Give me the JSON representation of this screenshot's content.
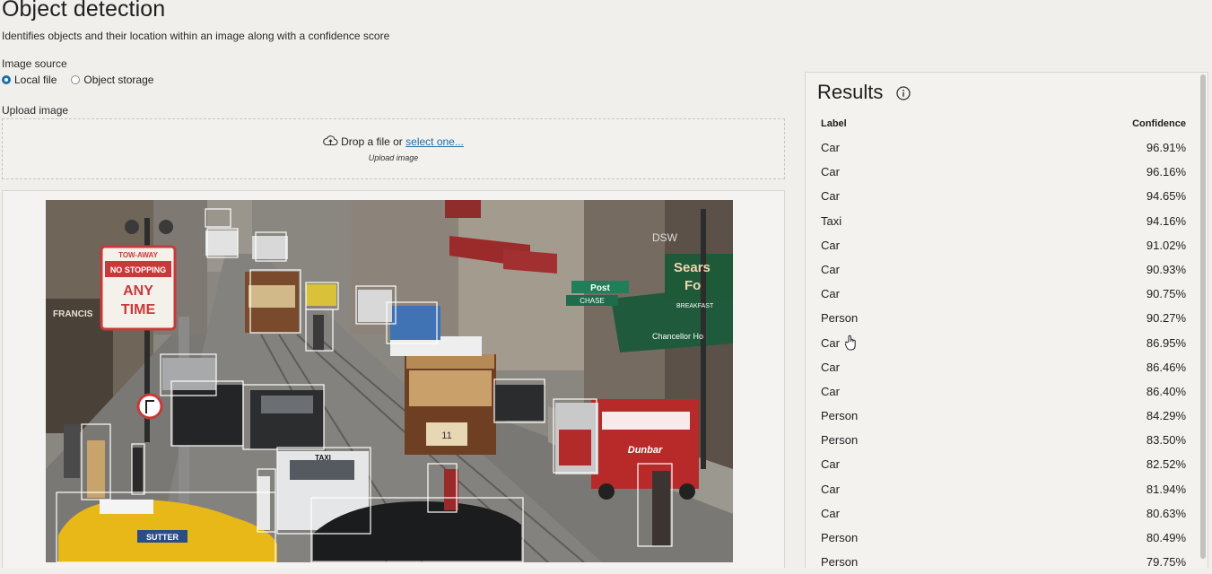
{
  "page": {
    "title": "Object detection",
    "subtitle": "Identifies objects and their location within an image along with a confidence score"
  },
  "image_source": {
    "label": "Image source",
    "options": [
      "Local file",
      "Object storage"
    ],
    "selected": "Local file"
  },
  "upload": {
    "label": "Upload image",
    "drop_text": "Drop a file or",
    "select_link": "select one...",
    "sub_label": "Upload image"
  },
  "street_signs": {
    "tow_away": "TOW-AWAY",
    "no_stopping": "NO STOPPING",
    "any": "ANY",
    "time": "TIME",
    "post": "Post",
    "chase": "CHASE",
    "chancellor": "Chancellor Ho",
    "breakfast": "BREAKFAST",
    "dunbar": "Dunbar",
    "sutter": "SUTTER",
    "taxi": "TAXI",
    "francis": "FRANCIS",
    "dsw": "DSW",
    "sears": "Sears",
    "fine": "Fo",
    "cable_num": "11"
  },
  "results": {
    "title": "Results",
    "headers": {
      "label": "Label",
      "confidence": "Confidence"
    },
    "rows": [
      {
        "label": "Car",
        "confidence": "96.91%"
      },
      {
        "label": "Car",
        "confidence": "96.16%"
      },
      {
        "label": "Car",
        "confidence": "94.65%"
      },
      {
        "label": "Taxi",
        "confidence": "94.16%"
      },
      {
        "label": "Car",
        "confidence": "91.02%"
      },
      {
        "label": "Car",
        "confidence": "90.93%"
      },
      {
        "label": "Car",
        "confidence": "90.75%"
      },
      {
        "label": "Person",
        "confidence": "90.27%"
      },
      {
        "label": "Car",
        "confidence": "86.95%"
      },
      {
        "label": "Car",
        "confidence": "86.46%"
      },
      {
        "label": "Car",
        "confidence": "86.40%"
      },
      {
        "label": "Person",
        "confidence": "84.29%"
      },
      {
        "label": "Person",
        "confidence": "83.50%"
      },
      {
        "label": "Car",
        "confidence": "82.52%"
      },
      {
        "label": "Car",
        "confidence": "81.94%"
      },
      {
        "label": "Car",
        "confidence": "80.63%"
      },
      {
        "label": "Person",
        "confidence": "80.49%"
      },
      {
        "label": "Person",
        "confidence": "79.75%"
      }
    ]
  },
  "colors": {
    "accent": "#1e6fa6",
    "background": "#f1efec",
    "box": "#ffffff"
  }
}
